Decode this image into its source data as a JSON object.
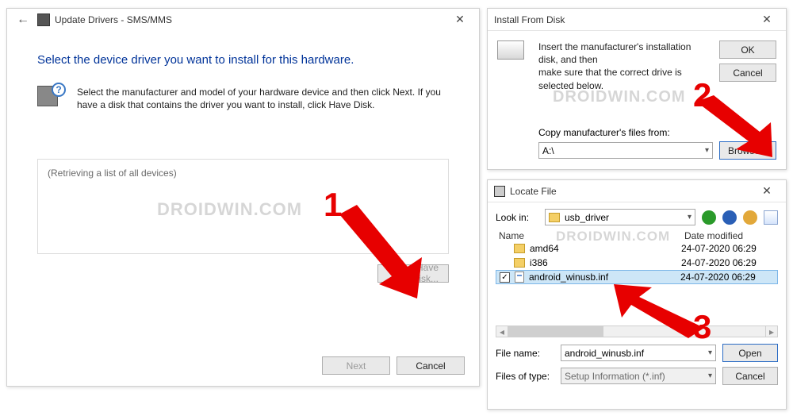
{
  "watermark": "DROIDWIN.COM",
  "dialog1": {
    "title_prefix": "Update Drivers - ",
    "device": "SMS/MMS",
    "heading": "Select the device driver you want to install for this hardware.",
    "body": "Select the manufacturer and model of your hardware device and then click Next. If you have a disk that contains the driver you want to install, click Have Disk.",
    "list_status": "(Retrieving a list of all devices)",
    "have_disk": "Have Disk...",
    "next": "Next",
    "cancel": "Cancel"
  },
  "dialog2": {
    "title": "Install From Disk",
    "body_line1": "Insert the manufacturer's installation disk, and then",
    "body_line2": "make sure that the correct drive is selected below.",
    "ok": "OK",
    "cancel": "Cancel",
    "copy_label": "Copy manufacturer's files from:",
    "path": "A:\\",
    "browse": "Browse..."
  },
  "dialog3": {
    "title": "Locate File",
    "look_in_label": "Look in:",
    "look_in_value": "usb_driver",
    "col_name": "Name",
    "col_date": "Date modified",
    "rows": [
      {
        "name": "amd64",
        "date": "24-07-2020 06:29",
        "type": "folder"
      },
      {
        "name": "i386",
        "date": "24-07-2020 06:29",
        "type": "folder"
      },
      {
        "name": "android_winusb.inf",
        "date": "24-07-2020 06:29",
        "type": "file",
        "selected": true,
        "checked": true
      }
    ],
    "file_name_label": "File name:",
    "file_name_value": "android_winusb.inf",
    "files_of_type_label": "Files of type:",
    "files_of_type_value": "Setup Information (*.inf)",
    "open": "Open",
    "cancel": "Cancel"
  },
  "annotations": {
    "a1": "1",
    "a2": "2",
    "a3": "3"
  }
}
